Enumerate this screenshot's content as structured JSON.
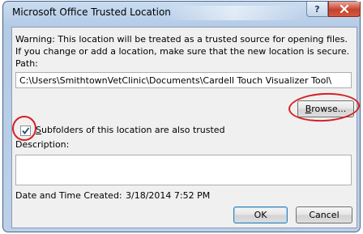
{
  "dialog": {
    "title": "Microsoft Office Trusted Location",
    "warning": "Warning: This location will be treated as a trusted source for opening files. If you change or add a location, make sure that the new location is secure.",
    "path_label": "Path:",
    "path_value": "C:\\Users\\SmithtownVetClinic\\Documents\\Cardell Touch Visualizer Tool\\",
    "browse_label": "rowse...",
    "browse_accel": "B",
    "subfolders_accel": "S",
    "subfolders_label": "ubfolders of this location are also trusted",
    "subfolders_checked": true,
    "description_label": "Description:",
    "description_value": "",
    "date_created_label": "Date and Time Created:",
    "date_created_value": "3/18/2014 7:52 PM",
    "ok_label": "OK",
    "cancel_label": "Cancel"
  },
  "icons": {
    "help": "help-icon",
    "close": "close-icon",
    "check": "check-icon"
  },
  "colors": {
    "annotation_red": "#d32222",
    "close_red": "#c7422f",
    "title_bar_blue": "#b4cbe6"
  }
}
